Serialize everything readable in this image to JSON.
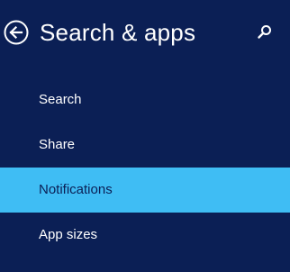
{
  "header": {
    "title": "Search & apps",
    "back_icon": "back-arrow-circle-icon",
    "search_icon": "search-icon"
  },
  "menu": {
    "items": [
      {
        "label": "Search",
        "selected": false
      },
      {
        "label": "Share",
        "selected": false
      },
      {
        "label": "Notifications",
        "selected": true
      },
      {
        "label": "App sizes",
        "selected": false
      }
    ]
  },
  "colors": {
    "background": "#0b1f55",
    "selected": "#3fbdf4",
    "text": "#ffffff"
  }
}
